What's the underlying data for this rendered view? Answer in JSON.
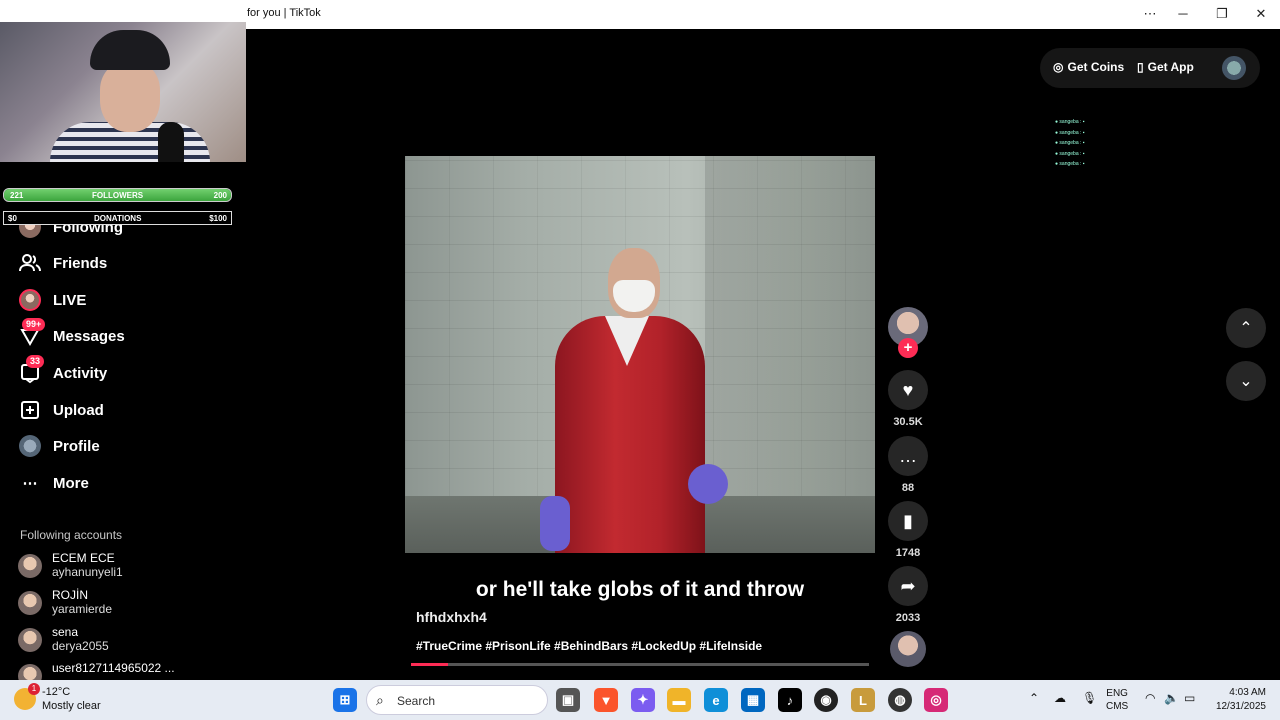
{
  "window": {
    "title": "for you | TikTok",
    "more_icon": "more-horizontal-icon",
    "min_icon": "minimize-icon",
    "max_icon": "restore-icon",
    "close_icon": "close-icon"
  },
  "stream_overlay": {
    "followers_bar": {
      "left": "221",
      "label": "FOLLOWERS",
      "right": "200",
      "fill_fraction": 1.0
    },
    "donations_bar": {
      "left": "$0",
      "label": "DONATIONS",
      "right": "$100",
      "fill_fraction": 0
    }
  },
  "sidebar": {
    "items": [
      {
        "label": "Following",
        "icon": "following-avatar-icon"
      },
      {
        "label": "Friends",
        "icon": "friends-icon"
      },
      {
        "label": "LIVE",
        "icon": "live-icon"
      },
      {
        "label": "Messages",
        "icon": "messages-icon",
        "badge": "99+"
      },
      {
        "label": "Activity",
        "icon": "activity-icon",
        "badge": "33"
      },
      {
        "label": "Upload",
        "icon": "upload-icon"
      },
      {
        "label": "Profile",
        "icon": "profile-avatar-icon"
      },
      {
        "label": "More",
        "icon": "more-icon"
      }
    ],
    "following_title": "Following accounts",
    "accounts": [
      {
        "name": "ECEM ECE",
        "handle": "ayhanunyeli1"
      },
      {
        "name": "ROJİN",
        "handle": "yaramierde"
      },
      {
        "name": "sena",
        "handle": "derya2055"
      },
      {
        "name": "user8127114965022 ...",
        "handle": ""
      }
    ]
  },
  "header": {
    "get_coins": "Get Coins",
    "get_app": "Get App"
  },
  "video": {
    "caption": "or he'll take globs of it and throw",
    "author": "hfhdxhxh4",
    "hashtags": "#TrueCrime #PrisonLife #BehindBars #LockedUp #LifeInside",
    "progress": 0.08
  },
  "actions": {
    "likes": "30.5K",
    "comments": "88",
    "saves": "1748",
    "shares": "2033"
  },
  "taskbar": {
    "weather_temp": "-12°C",
    "weather_desc": "Mostly clear",
    "weather_alert": "1",
    "search_label": "Search",
    "lang1": "ENG",
    "lang2": "CMS",
    "time": "4:03 AM",
    "date": "12/31/2025"
  }
}
